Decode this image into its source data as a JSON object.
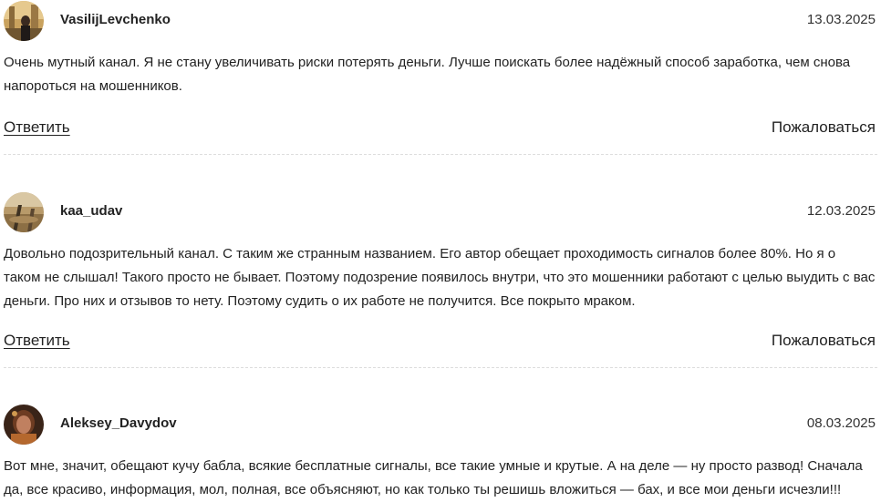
{
  "comments": [
    {
      "author": "VasilijLevchenko",
      "date": "13.03.2025",
      "text": "Очень мутный канал. Я не стану увеличивать риски потерять деньги. Лучше поискать более надёжный способ заработка, чем снова напороться на мошенников.",
      "reply_label": "Ответить",
      "report_label": "Пожаловаться"
    },
    {
      "author": "kaa_udav",
      "date": "12.03.2025",
      "text": "Довольно подозрительный канал. С таким же странным названием. Его автор обещает проходимость сигналов более 80%. Но я о таком не слышал! Такого просто не бывает. Поэтому подозрение появилось внутри, что это мошенники работают с целью выудить с вас деньги. Про них и отзывов то нету. Поэтому судить о их работе не получится. Все покрыто мраком.",
      "reply_label": "Ответить",
      "report_label": "Пожаловаться"
    },
    {
      "author": "Aleksey_Davydov",
      "date": "08.03.2025",
      "text": "Вот мне, значит, обещают кучу бабла, всякие бесплатные сигналы, все такие умные и крутые. А на деле — ну просто развод! Сначала да, все красиво, информация, мол, полная, все объясняют, но как только ты решишь вложиться — бах, и все мои деньги исчезли!!!"
    }
  ]
}
